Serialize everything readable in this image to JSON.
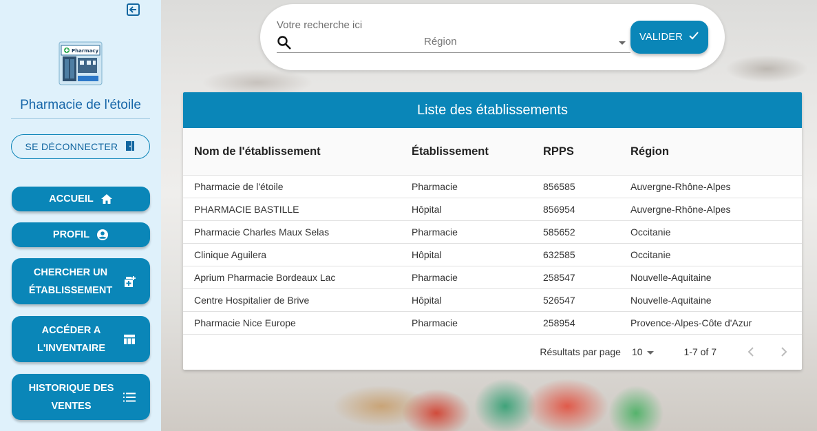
{
  "sidebar": {
    "pharmacy_name": "Pharmacie de l'étoile",
    "logo_text": "Pharmacy",
    "logout_label": "SE DÉCONNECTER",
    "nav": [
      {
        "label": "ACCUEIL",
        "icon": "home-icon"
      },
      {
        "label": "PROFIL",
        "icon": "account-circle-icon"
      },
      {
        "label": "CHERCHER UN ÉTABLISSEMENT",
        "icon": "medical-add-icon"
      },
      {
        "label": "ACCÉDER A L'INVENTAIRE",
        "icon": "table-icon"
      },
      {
        "label": "HISTORIQUE DES VENTES",
        "icon": "list-icon"
      }
    ]
  },
  "search": {
    "placeholder": "Votre recherche ici",
    "value": "",
    "region_placeholder": "Région",
    "submit_label": "VALIDER"
  },
  "table": {
    "title": "Liste des établissements",
    "columns": [
      "Nom de l'établissement",
      "Établissement",
      "RPPS",
      "Région"
    ],
    "rows": [
      [
        "Pharmacie de l'étoile",
        "Pharmacie",
        "856585",
        "Auvergne-Rhône-Alpes"
      ],
      [
        "PHARMACIE BASTILLE",
        "Hôpital",
        "856954",
        "Auvergne-Rhône-Alpes"
      ],
      [
        "Pharmacie Charles Maux Selas",
        "Pharmacie",
        "585652",
        "Occitanie"
      ],
      [
        "Clinique Aguilera",
        "Hôpital",
        "632585",
        "Occitanie"
      ],
      [
        "Aprium Pharmacie Bordeaux Lac",
        "Pharmacie",
        "258547",
        "Nouvelle-Aquitaine"
      ],
      [
        "Centre Hospitalier de Brive",
        "Hôpital",
        "526547",
        "Nouvelle-Aquitaine"
      ],
      [
        "Pharmacie Nice Europe",
        "Pharmacie",
        "258954",
        "Provence-Alpes-Côte d'Azur"
      ]
    ]
  },
  "paginator": {
    "label": "Résultats par page",
    "page_size": "10",
    "range": "1-7 of 7"
  },
  "colors": {
    "primary": "#0a86b8",
    "sidebar_bg": "#dff1fb",
    "title_text": "#1565a8"
  }
}
